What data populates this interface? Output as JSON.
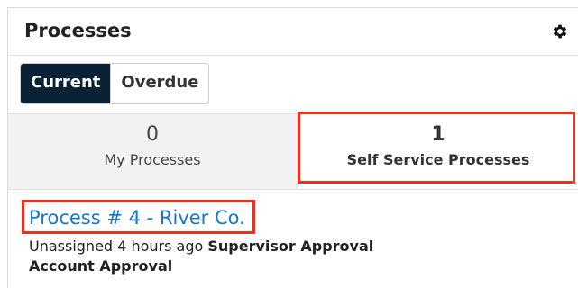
{
  "dashlet": {
    "title": "Processes",
    "settings_icon": "gear-icon"
  },
  "toggle": {
    "current_label": "Current",
    "overdue_label": "Overdue",
    "selected": "Current"
  },
  "tabs": [
    {
      "count": "0",
      "label": "My Processes",
      "active": false
    },
    {
      "count": "1",
      "label": "Self Service Processes",
      "active": true
    }
  ],
  "process_item": {
    "link_text": "Process  #  4 - River Co.",
    "assignment": "Unassigned",
    "time_ago": "4 hours ago",
    "activity": "Supervisor Approval",
    "process_definition": "Account Approval"
  },
  "colors": {
    "toggle_active_bg": "#0b2236",
    "link": "#1677c8",
    "highlight": "#e8311f"
  }
}
